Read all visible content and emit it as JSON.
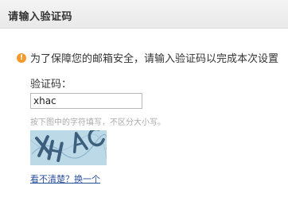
{
  "header": {
    "title": "请输入验证码"
  },
  "notice": {
    "icon": "info-icon",
    "icon_glyph": "!",
    "text": "为了保障您的邮箱安全，请输入验证码以完成本次设置"
  },
  "form": {
    "label": "验证码：",
    "input_value": "xhac",
    "hint": "按下图中的字符填写，不区分大小写。"
  },
  "captcha": {
    "text": "XHAC",
    "colors": {
      "background": "#bcd9e8",
      "glyphs": "#3d5f7e"
    }
  },
  "refresh": {
    "link_label": "看不清楚？换一个"
  },
  "colors": {
    "accent_icon": "#f29a2e",
    "link": "#2a4f9a"
  }
}
